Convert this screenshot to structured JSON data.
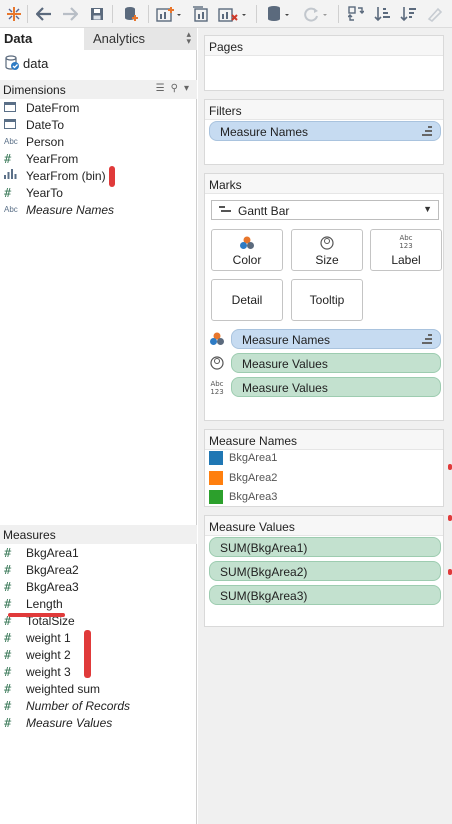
{
  "toolbar": {
    "icons": [
      "tableau-logo-icon",
      "back-icon",
      "forward-icon",
      "save-icon",
      "new-datasource-icon",
      "new-worksheet-icon",
      "clear-sheet-icon",
      "data-icon",
      "refresh-icon",
      "swap-icon",
      "sort-ascending-icon",
      "sort-descending-icon",
      "highlight-icon"
    ]
  },
  "left": {
    "tabs": {
      "data": "Data",
      "analytics": "Analytics"
    },
    "datasource": "data",
    "dimensions_header": "Dimensions",
    "dimensions": [
      {
        "label": "DateFrom",
        "icon": "date-icon",
        "italic": false
      },
      {
        "label": "DateTo",
        "icon": "date-icon",
        "italic": false
      },
      {
        "label": "Person",
        "icon": "abc-icon",
        "italic": false
      },
      {
        "label": "YearFrom",
        "icon": "hash-icon",
        "italic": false
      },
      {
        "label": "YearFrom (bin)",
        "icon": "bin-icon",
        "italic": false
      },
      {
        "label": "YearTo",
        "icon": "hash-icon",
        "italic": false
      },
      {
        "label": "Measure Names",
        "icon": "abc-icon",
        "italic": true
      }
    ],
    "measures_header": "Measures",
    "measures": [
      {
        "label": "BkgArea1",
        "italic": false
      },
      {
        "label": "BkgArea2",
        "italic": false
      },
      {
        "label": "BkgArea3",
        "italic": false
      },
      {
        "label": "Length",
        "italic": false
      },
      {
        "label": "TotalSize",
        "italic": false
      },
      {
        "label": "weight 1",
        "italic": false
      },
      {
        "label": "weight 2",
        "italic": false
      },
      {
        "label": "weight 3",
        "italic": false
      },
      {
        "label": "weighted sum",
        "italic": false
      },
      {
        "label": "Number of Records",
        "italic": true
      },
      {
        "label": "Measure Values",
        "italic": true
      }
    ]
  },
  "shelves": {
    "pages_title": "Pages",
    "filters_title": "Filters",
    "filter_pill": "Measure Names",
    "marks_title": "Marks",
    "mark_type": "Gantt Bar",
    "buttons": {
      "color": "Color",
      "size": "Size",
      "label": "Label",
      "detail": "Detail",
      "tooltip": "Tooltip"
    },
    "label_icon_text": "Abc\n123",
    "mark_fields": [
      {
        "label": "Measure Names",
        "kind": "color",
        "pill": "blue"
      },
      {
        "label": "Measure Values",
        "kind": "size",
        "pill": "green"
      },
      {
        "label": "Measure Values",
        "kind": "label",
        "pill": "green"
      }
    ],
    "abc_icon_text": "Abc 123",
    "legend_title": "Measure Names",
    "legend": [
      {
        "label": "BkgArea1",
        "color": "#1f77b4"
      },
      {
        "label": "BkgArea2",
        "color": "#ff7f0e"
      },
      {
        "label": "BkgArea3",
        "color": "#2ca02c"
      }
    ],
    "values_title": "Measure Values",
    "values": [
      "SUM(BkgArea1)",
      "SUM(BkgArea2)",
      "SUM(BkgArea3)"
    ]
  }
}
